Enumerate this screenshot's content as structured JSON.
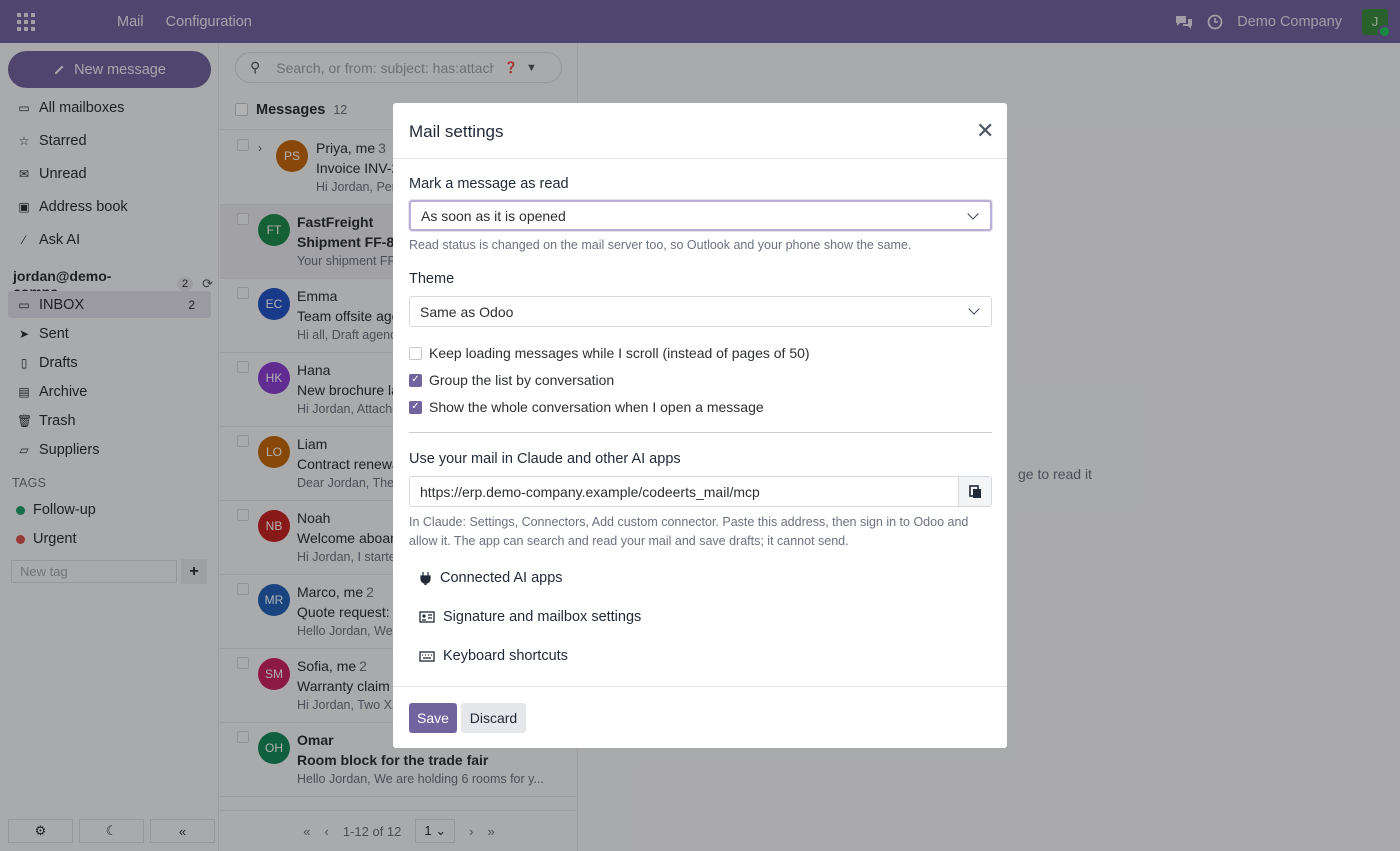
{
  "topbar": {
    "brand": "Mail",
    "menu": "Configuration",
    "company": "Demo Company",
    "user_initial": "J"
  },
  "sidebar": {
    "new_message": "New message",
    "quick": [
      {
        "label": "All mailboxes",
        "icon": "inbox-icon"
      },
      {
        "label": "Starred",
        "icon": "star-icon"
      },
      {
        "label": "Unread",
        "icon": "envelope-icon"
      },
      {
        "label": "Address book",
        "icon": "address-book-icon"
      },
      {
        "label": "Ask AI",
        "icon": "magic-wand-icon"
      }
    ],
    "account": "jordan@demo-compa...",
    "account_count": "2",
    "folders": [
      {
        "label": "INBOX",
        "count": "2",
        "icon": "inbox-icon"
      },
      {
        "label": "Sent",
        "icon": "send-icon"
      },
      {
        "label": "Drafts",
        "icon": "draft-icon"
      },
      {
        "label": "Archive",
        "icon": "archive-icon"
      },
      {
        "label": "Trash",
        "icon": "trash-icon"
      },
      {
        "label": "Suppliers",
        "icon": "folder-icon"
      }
    ],
    "tags_heading": "TAGS",
    "tags": [
      {
        "label": "Follow-up",
        "color": "#22a06b"
      },
      {
        "label": "Urgent",
        "color": "#d9534f"
      }
    ],
    "new_tag_placeholder": "New tag"
  },
  "list": {
    "search_placeholder": "Search, or from: subject: has:attachm",
    "title": "Messages",
    "count": "12",
    "rows": [
      {
        "initials": "PS",
        "color": "#c2680e",
        "from": "Priya, me",
        "thread": "3",
        "subject": "Invoice INV-2",
        "preview": "Hi Jordan, Per",
        "unread": false
      },
      {
        "initials": "FT",
        "color": "#1f8a4c",
        "from": "FastFreight",
        "thread": "",
        "subject": "Shipment FF-88",
        "preview": "Your shipment FF-",
        "unread": true
      },
      {
        "initials": "EC",
        "color": "#2453c4",
        "from": "Emma",
        "thread": "",
        "subject": "Team offsite age",
        "preview": "Hi all, Draft agend",
        "unread": false
      },
      {
        "initials": "HK",
        "color": "#8a3fd1",
        "from": "Hana",
        "thread": "",
        "subject": "New brochure la",
        "preview": "Hi Jordan, Attache",
        "unread": false
      },
      {
        "initials": "LO",
        "color": "#c2680e",
        "from": "Liam",
        "thread": "",
        "subject": "Contract renewa",
        "preview": "Dear Jordan, The",
        "unread": false
      },
      {
        "initials": "NB",
        "color": "#c42525",
        "from": "Noah",
        "thread": "",
        "subject": "Welcome aboard",
        "preview": "Hi Jordan, I starte",
        "unread": false
      },
      {
        "initials": "MR",
        "color": "#2462b8",
        "from": "Marco, me",
        "thread": "2",
        "subject": "Quote request: 4",
        "preview": "Hello Jordan, We",
        "unread": false
      },
      {
        "initials": "SM",
        "color": "#c7245e",
        "from": "Sofia, me",
        "thread": "2",
        "subject": "Warranty claim f",
        "preview": "Hi Jordan, Two X2",
        "unread": false
      },
      {
        "initials": "OH",
        "color": "#168a5a",
        "from": "Omar",
        "thread": "",
        "subject": "Room block for the trade fair",
        "preview": "Hello Jordan, We are holding 6 rooms for y...",
        "unread": true
      }
    ],
    "pager": {
      "range": "1-12 of 12",
      "page": "1"
    }
  },
  "reader": {
    "hint": "ge to read it"
  },
  "modal": {
    "title": "Mail settings",
    "mark_read_label": "Mark a message as read",
    "mark_read_value": "As soon as it is opened",
    "mark_read_help": "Read status is changed on the mail server too, so Outlook and your phone show the same.",
    "theme_label": "Theme",
    "theme_value": "Same as Odoo",
    "options": [
      {
        "label": "Keep loading messages while I scroll (instead of pages of 50)",
        "checked": false
      },
      {
        "label": "Group the list by conversation",
        "checked": true
      },
      {
        "label": "Show the whole conversation when I open a message",
        "checked": true
      }
    ],
    "ai_label": "Use your mail in Claude and other AI apps",
    "mcp_url": "https://erp.demo-company.example/codeerts_mail/mcp",
    "ai_help": "In Claude: Settings, Connectors, Add custom connector. Paste this address, then sign in to Odoo and allow it. The app can search and read your mail and save drafts; it cannot send.",
    "links": [
      {
        "label": "Connected AI apps",
        "icon": "plug-icon"
      },
      {
        "label": "Signature and mailbox settings",
        "icon": "id-card-icon"
      },
      {
        "label": "Keyboard shortcuts",
        "icon": "keyboard-icon"
      }
    ],
    "save": "Save",
    "discard": "Discard"
  }
}
